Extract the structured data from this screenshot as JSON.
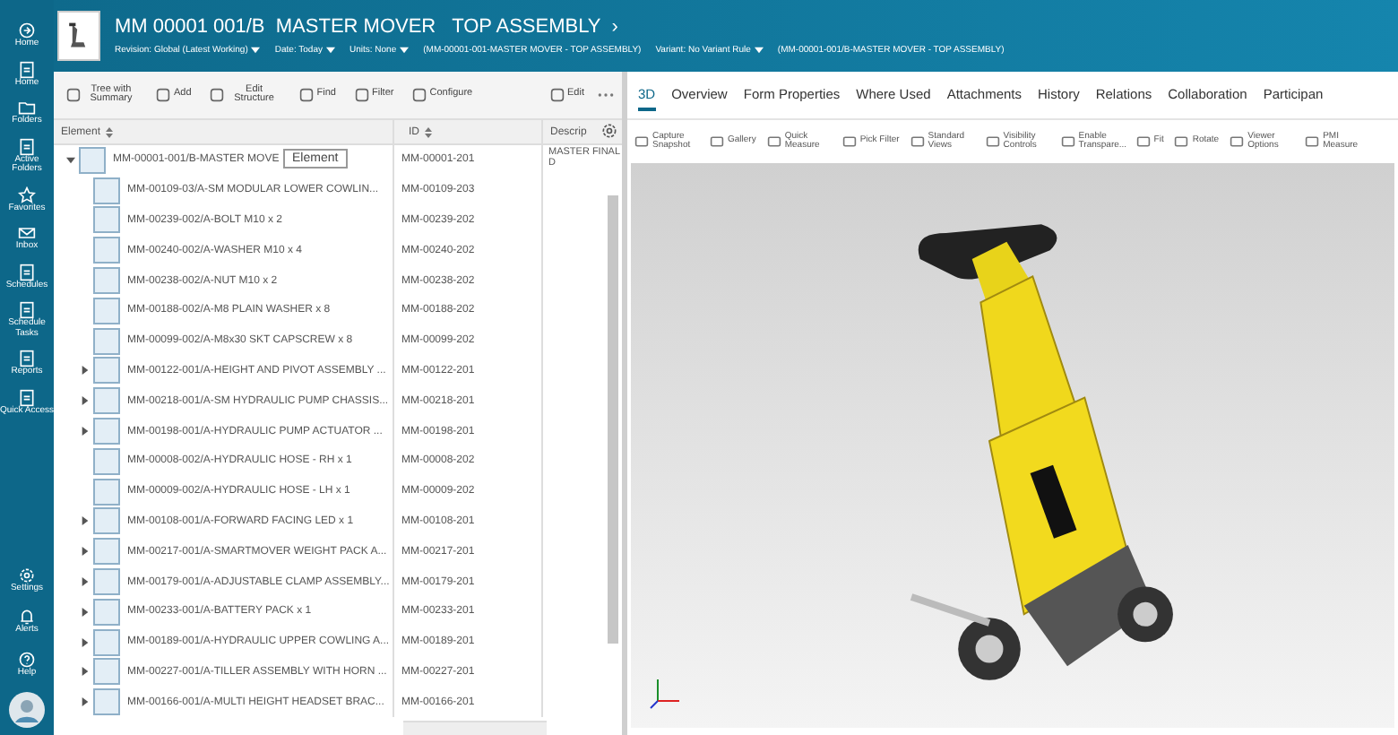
{
  "nav": {
    "items": [
      {
        "label": "Home"
      },
      {
        "label": "Home"
      },
      {
        "label": "Folders"
      },
      {
        "label": "Active Folders"
      },
      {
        "label": "Favorites"
      },
      {
        "label": "Inbox"
      },
      {
        "label": "Schedules"
      },
      {
        "label": "Schedule Tasks"
      },
      {
        "label": "Reports"
      },
      {
        "label": "Quick Access"
      }
    ],
    "bottom": [
      {
        "label": "Settings"
      },
      {
        "label": "Alerts"
      },
      {
        "label": "Help"
      }
    ]
  },
  "header": {
    "title": "MM 00001 001/B  MASTER MOVER   TOP ASSEMBLY",
    "chevron": "›",
    "filters": [
      {
        "label": "Revision:",
        "value": "Global (Latest Working)"
      },
      {
        "label": "Date:",
        "value": "Today"
      },
      {
        "label": "Units:",
        "value": "None"
      }
    ],
    "context": "(MM-00001-001-MASTER MOVER - TOP ASSEMBLY)",
    "variant": {
      "label": "Variant:",
      "value": "No Variant Rule"
    },
    "variant_context": "(MM-00001-001/B-MASTER MOVER - TOP ASSEMBLY)"
  },
  "tree_toolbar": [
    "Tree with Summary",
    "Add",
    "Edit Structure",
    "Find",
    "Filter",
    "Configure",
    "Edit"
  ],
  "table": {
    "columns": [
      "Element",
      "ID",
      "Descrip"
    ],
    "tooltip": "Element",
    "rows": [
      {
        "kind": "assembly",
        "expanded": true,
        "name": "MM-00001-001/B-MASTER MOVE",
        "id": "MM-00001-201",
        "desc": "MASTER FINAL D",
        "children": [
          {
            "kind": "part",
            "name": "MM-00109-03/A-SM MODULAR LOWER COWLIN...",
            "id": "MM-00109-203"
          },
          {
            "kind": "part",
            "name": "MM-00239-002/A-BOLT M10 x 2",
            "id": "MM-00239-202"
          },
          {
            "kind": "part",
            "name": "MM-00240-002/A-WASHER M10 x 4",
            "id": "MM-00240-202"
          },
          {
            "kind": "part",
            "name": "MM-00238-002/A-NUT M10 x 2",
            "id": "MM-00238-202"
          },
          {
            "kind": "part",
            "name": "MM-00188-002/A-M8 PLAIN WASHER x 8",
            "id": "MM-00188-202"
          },
          {
            "kind": "part",
            "name": "MM-00099-002/A-M8x30 SKT CAPSCREW x 8",
            "id": "MM-00099-202"
          },
          {
            "kind": "assembly",
            "expanded": false,
            "name": "MM-00122-001/A-HEIGHT AND PIVOT ASSEMBLY ...",
            "id": "MM-00122-201"
          },
          {
            "kind": "assembly",
            "expanded": false,
            "name": "MM-00218-001/A-SM HYDRAULIC PUMP CHASSIS...",
            "id": "MM-00218-201"
          },
          {
            "kind": "assembly",
            "expanded": false,
            "name": "MM-00198-001/A-HYDRAULIC PUMP ACTUATOR ...",
            "id": "MM-00198-201"
          },
          {
            "kind": "part",
            "name": "MM-00008-002/A-HYDRAULIC HOSE - RH x 1",
            "id": "MM-00008-202"
          },
          {
            "kind": "part",
            "name": "MM-00009-002/A-HYDRAULIC HOSE - LH x 1",
            "id": "MM-00009-202"
          },
          {
            "kind": "assembly",
            "expanded": false,
            "name": "MM-00108-001/A-FORWARD FACING LED x 1",
            "id": "MM-00108-201"
          },
          {
            "kind": "assembly",
            "expanded": false,
            "name": "MM-00217-001/A-SMARTMOVER WEIGHT PACK A...",
            "id": "MM-00217-201"
          },
          {
            "kind": "assembly",
            "expanded": false,
            "name": "MM-00179-001/A-ADJUSTABLE CLAMP ASSEMBLY...",
            "id": "MM-00179-201"
          },
          {
            "kind": "assembly",
            "expanded": false,
            "name": "MM-00233-001/A-BATTERY PACK x 1",
            "id": "MM-00233-201"
          },
          {
            "kind": "assembly",
            "expanded": false,
            "name": "MM-00189-001/A-HYDRAULIC UPPER COWLING A...",
            "id": "MM-00189-201"
          },
          {
            "kind": "assembly",
            "expanded": false,
            "name": "MM-00227-001/A-TILLER ASSEMBLY WITH HORN ...",
            "id": "MM-00227-201"
          },
          {
            "kind": "assembly",
            "expanded": false,
            "name": "MM-00166-001/A-MULTI HEIGHT HEADSET BRAC...",
            "id": "MM-00166-201"
          }
        ]
      }
    ]
  },
  "tabs": [
    {
      "label": "3D",
      "selected": true
    },
    {
      "label": "Overview",
      "selected": false
    },
    {
      "label": "Form Properties",
      "selected": false
    },
    {
      "label": "Where Used",
      "selected": false
    },
    {
      "label": "Attachments",
      "selected": false
    },
    {
      "label": "History",
      "selected": false
    },
    {
      "label": "Relations",
      "selected": false
    },
    {
      "label": "Collaboration",
      "selected": false
    },
    {
      "label": "Participan",
      "selected": false
    }
  ],
  "viewer_toolbar": [
    "Capture Snapshot",
    "Gallery",
    "Quick Measure",
    "Pick Filter",
    "Standard Views",
    "Visibility Controls",
    "Enable Transpare...",
    "Fit",
    "Rotate",
    "Viewer Options",
    "PMI Measure"
  ]
}
